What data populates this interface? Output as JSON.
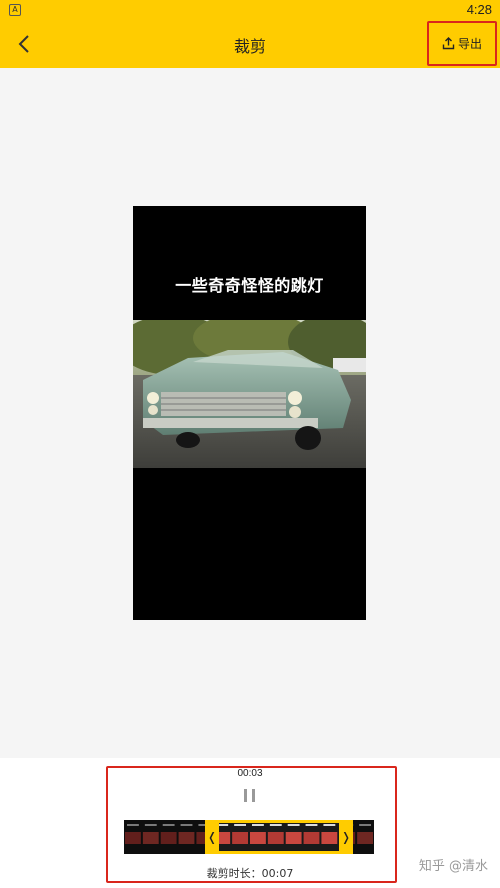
{
  "status": {
    "time": "4:28",
    "app_badge": "A"
  },
  "header": {
    "title": "裁剪",
    "export_label": "导出"
  },
  "video": {
    "caption": "一些奇奇怪怪的跳灯"
  },
  "trim": {
    "current_time": "00:03",
    "duration_label": "裁剪时长：00:07",
    "selection_start": 0.34,
    "selection_end": 0.89
  },
  "watermark": "知乎 @清水",
  "colors": {
    "accent": "#ffcc00",
    "annotation": "#d9261c",
    "background": "#f5f5f5"
  }
}
